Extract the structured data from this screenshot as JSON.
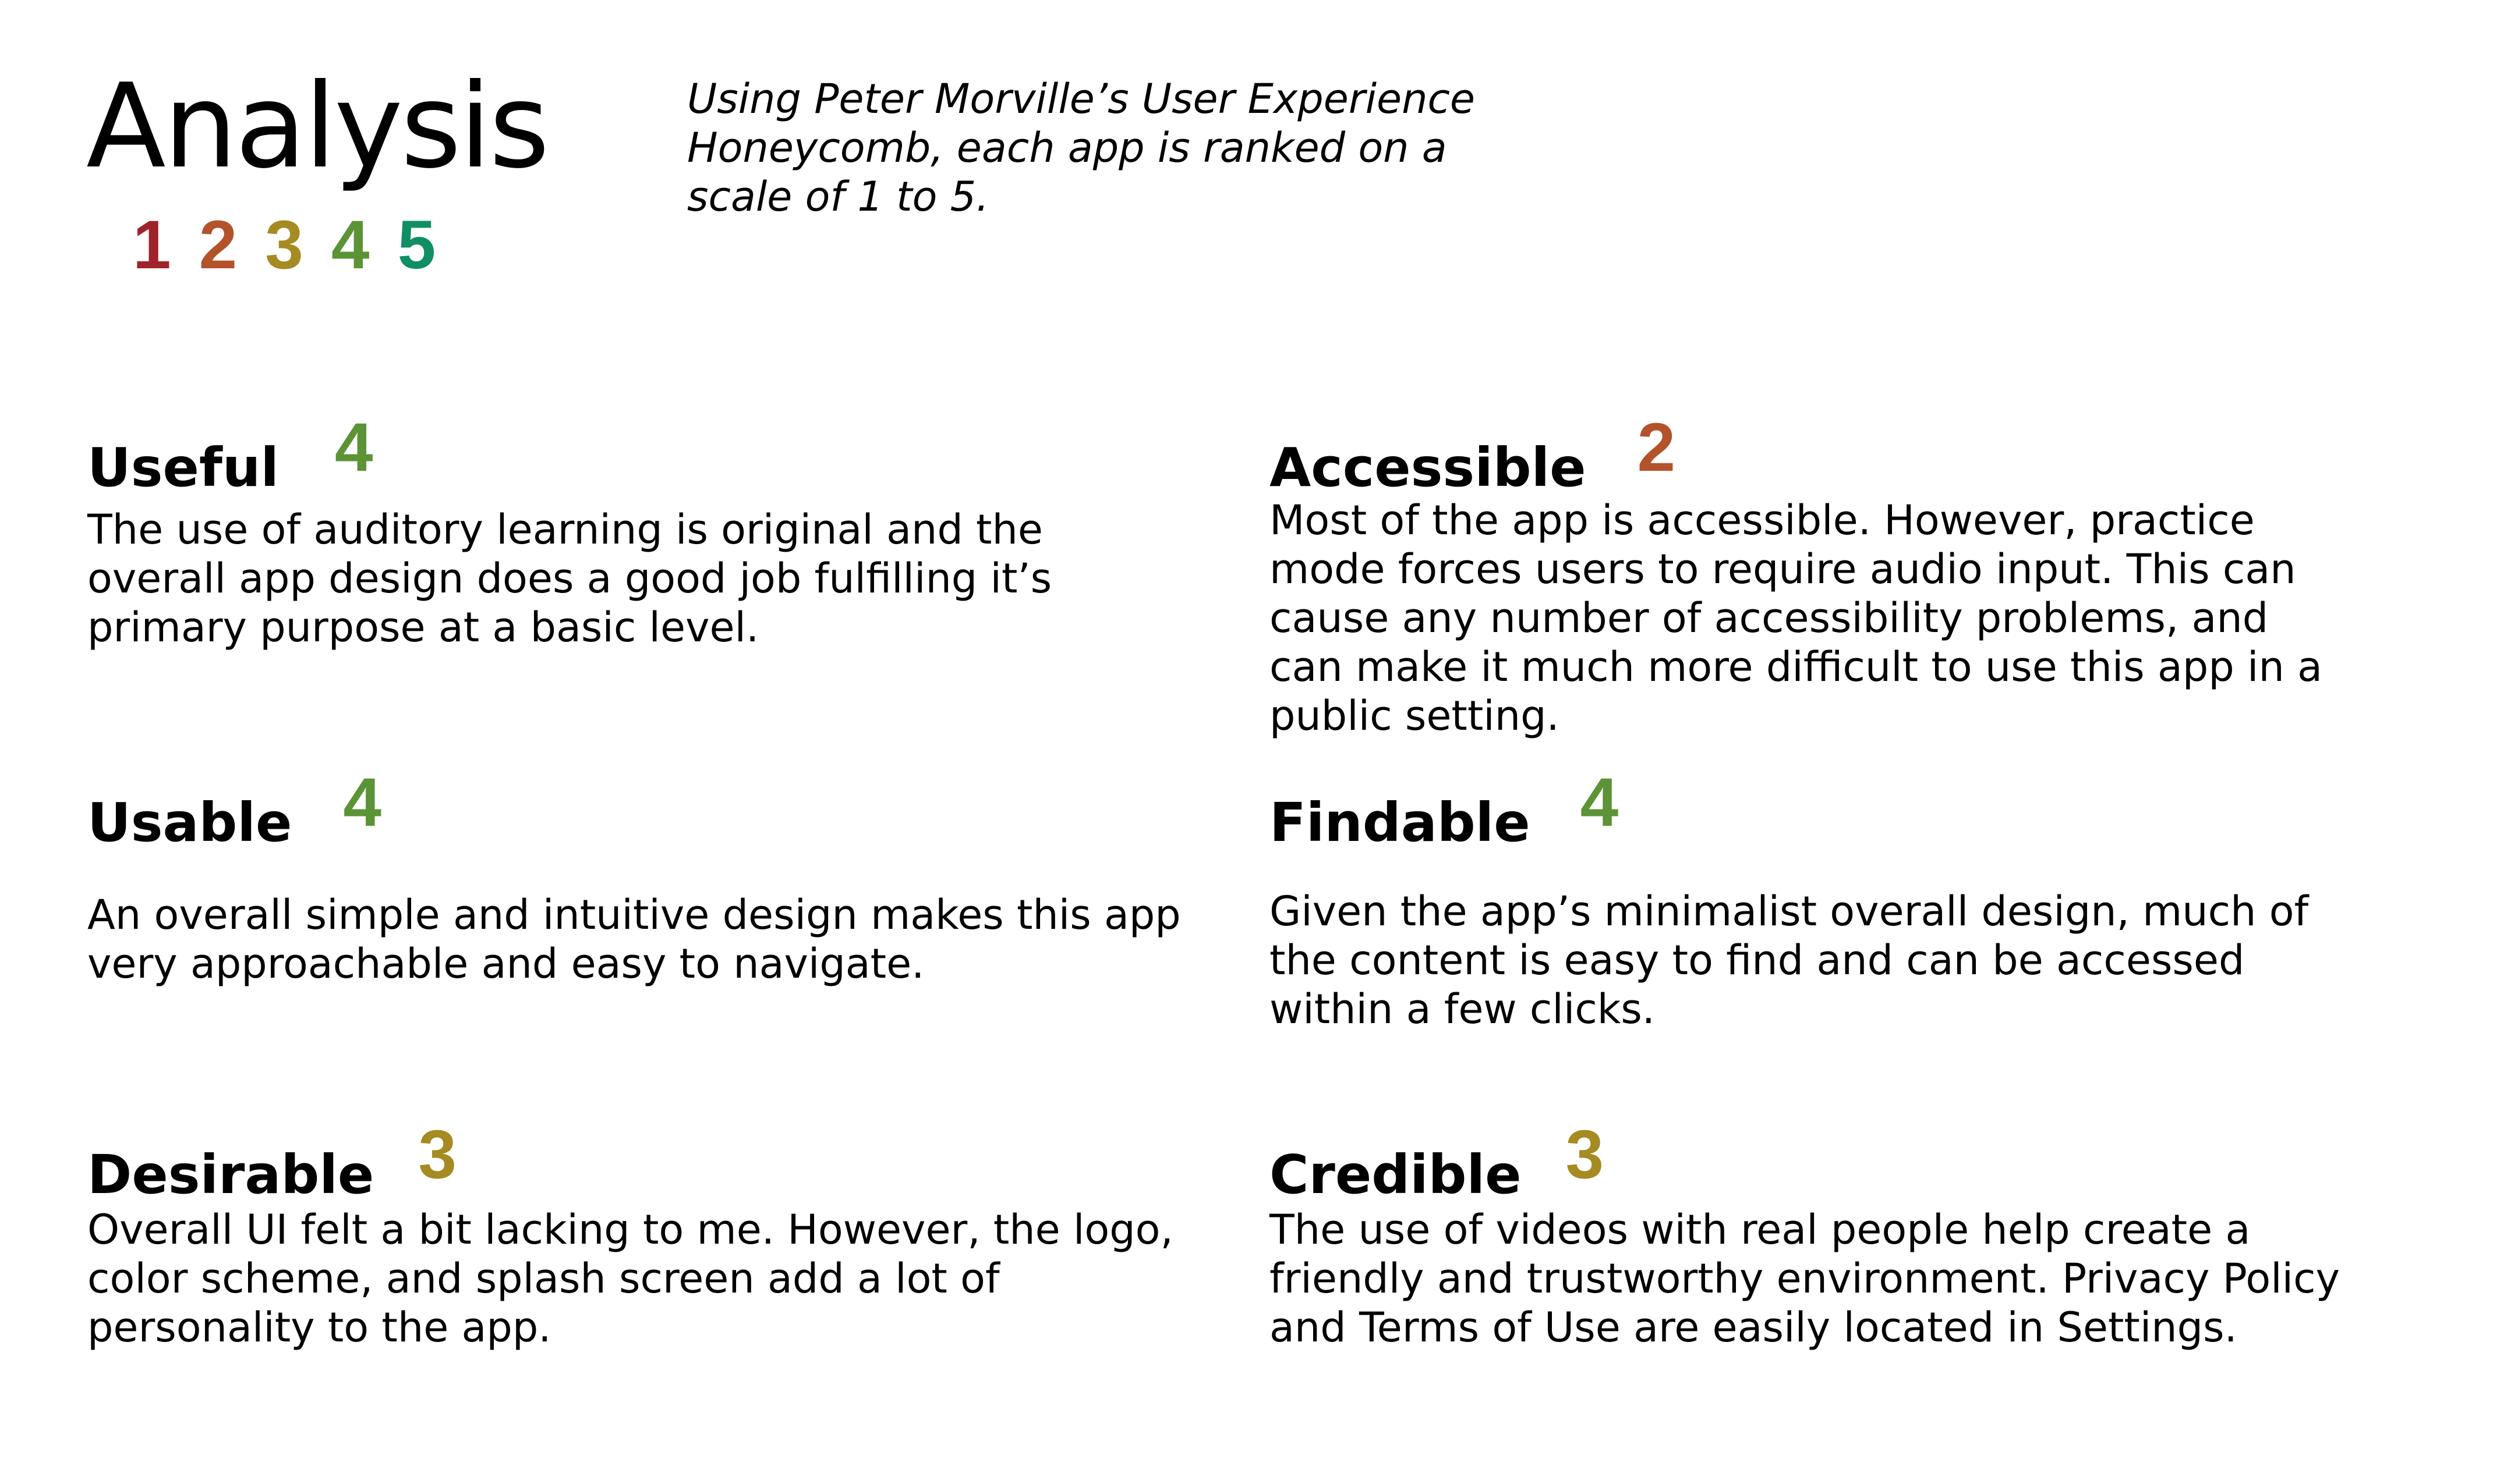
{
  "title": "Analysis",
  "intro": "Using Peter Morville’s User Experience Honeycomb, each app is ranked on a scale of 1 to 5.",
  "scale": [
    {
      "label": "1",
      "color": "#a0222a"
    },
    {
      "label": "2",
      "color": "#b4522a"
    },
    {
      "label": "3",
      "color": "#a68a22"
    },
    {
      "label": "4",
      "color": "#5b9336"
    },
    {
      "label": "5",
      "color": "#0f8f63"
    }
  ],
  "criteria": [
    {
      "name": "Useful",
      "score": "4",
      "score_color": "#5b9336",
      "description": "The use of auditory learning is original and the overall app design does a good job fulfilling it’s primary purpose at a basic level."
    },
    {
      "name": "Accessible",
      "score": "2",
      "score_color": "#b4522a",
      "description": "Most of the app is accessible. However, practice mode forces users to require audio input. This can cause any number of accessibility problems, and can make it much more difficult to use this app in a public setting."
    },
    {
      "name": "Usable",
      "score": "4",
      "score_color": "#5b9336",
      "description": "An overall simple and intuitive design makes this app very approachable and easy to navigate."
    },
    {
      "name": "Findable",
      "score": "4",
      "score_color": "#5b9336",
      "description": "Given the app’s minimalist overall design, much of the content is easy to find and can be accessed within a few clicks."
    },
    {
      "name": "Desirable",
      "score": "3",
      "score_color": "#a68a22",
      "description": "Overall UI felt a bit lacking to me. However, the logo, color scheme, and splash screen add a lot of personality to the app."
    },
    {
      "name": "Credible",
      "score": "3",
      "score_color": "#a68a22",
      "description": "The use of videos with real people help create a friendly and trustworthy environment. Privacy Policy and Terms of Use are easily located in Settings."
    }
  ]
}
